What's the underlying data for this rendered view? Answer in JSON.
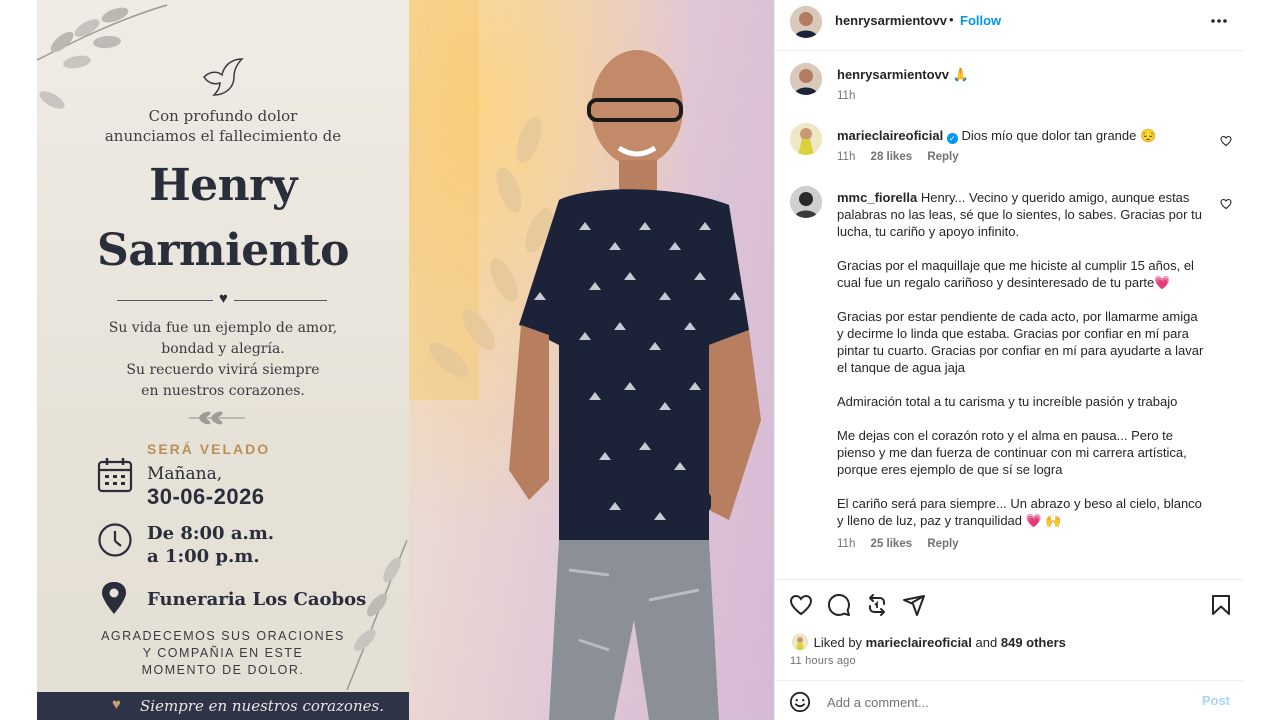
{
  "post": {
    "flyer": {
      "intro_line1": "Con profundo dolor",
      "intro_line2": "anunciamos el fallecimiento de",
      "name_line1": "Henry",
      "name_line2": "Sarmiento",
      "tribute_line1": "Su vida fue un ejemplo de amor,",
      "tribute_line2": "bondad y alegría.",
      "tribute_line3": "Su recuerdo vivirá siempre",
      "tribute_line4": "en nuestros corazones.",
      "velado_label": "SERÁ VELADO",
      "date_line1": "Mañana,",
      "date_line2": "30-06-2026",
      "time_line1": "De 8:00 a.m.",
      "time_line2": "a 1:00 p.m.",
      "place": "Funeraria Los Caobos",
      "thanks_line1": "AGRADECEMOS SUS ORACIONES",
      "thanks_line2": "Y COMPAÑIA EN ESTE",
      "thanks_line3": "MOMENTO DE DOLOR.",
      "footer": "Siempre en nuestros corazones."
    }
  },
  "header": {
    "username": "henrysarmientovv",
    "separator": "•",
    "follow_label": "Follow",
    "more_icon": "ellipsis-icon"
  },
  "caption": {
    "username": "henrysarmientovv",
    "emoji": "🙏",
    "time": "11h"
  },
  "comments": [
    {
      "username": "marieclaireoficial",
      "verified": true,
      "text": "Dios mío que dolor tan grande 😔",
      "time": "11h",
      "likes": "28 likes",
      "reply": "Reply"
    },
    {
      "username": "mmc_fiorella",
      "text_p1": "Henry... Vecino y querido amigo, aunque estas palabras no las leas, sé que lo sientes, lo sabes. Gracias por tu lucha, tu cariño y apoyo infinito.",
      "text_p2": "Gracias por el maquillaje que me hiciste al cumplir 15 años, el cual fue un regalo cariñoso y desinteresado de tu parte💗",
      "text_p3": "Gracias por estar pendiente de cada acto, por llamarme amiga y decirme lo linda que estaba. Gracias por confiar en mí para pintar tu cuarto. Gracias por confiar en mí para ayudarte a lavar el tanque de agua jaja",
      "text_p4": "Admiración total a tu carisma y tu increíble pasión y trabajo",
      "text_p5": "Me dejas con el corazón roto y el alma en pausa... Pero te pienso y me dan fuerza de continuar con mi carrera artística, porque eres ejemplo de que sí se logra",
      "text_p6": "El cariño será para siempre... Un abrazo y beso al cielo, blanco y lleno de luz, paz y tranquilidad 💗 🙌",
      "time": "11h",
      "likes": "25 likes",
      "reply": "Reply"
    }
  ],
  "actions": {
    "like_icon": "heart-icon",
    "comment_icon": "comment-icon",
    "repost_icon": "repost-icon",
    "share_icon": "send-icon",
    "save_icon": "bookmark-icon",
    "liked_by_prefix": "Liked by",
    "liked_by_user": "marieclaireoficial",
    "liked_by_and": "and",
    "liked_by_others": "849 others",
    "posted_time": "11 hours ago"
  },
  "add_comment": {
    "placeholder": "Add a comment...",
    "post_label": "Post",
    "emoji_icon": "smiley-icon"
  },
  "colors": {
    "accent": "#0095f6",
    "flyer_dark": "#2a2d3a",
    "flyer_gold": "#b8905a"
  }
}
